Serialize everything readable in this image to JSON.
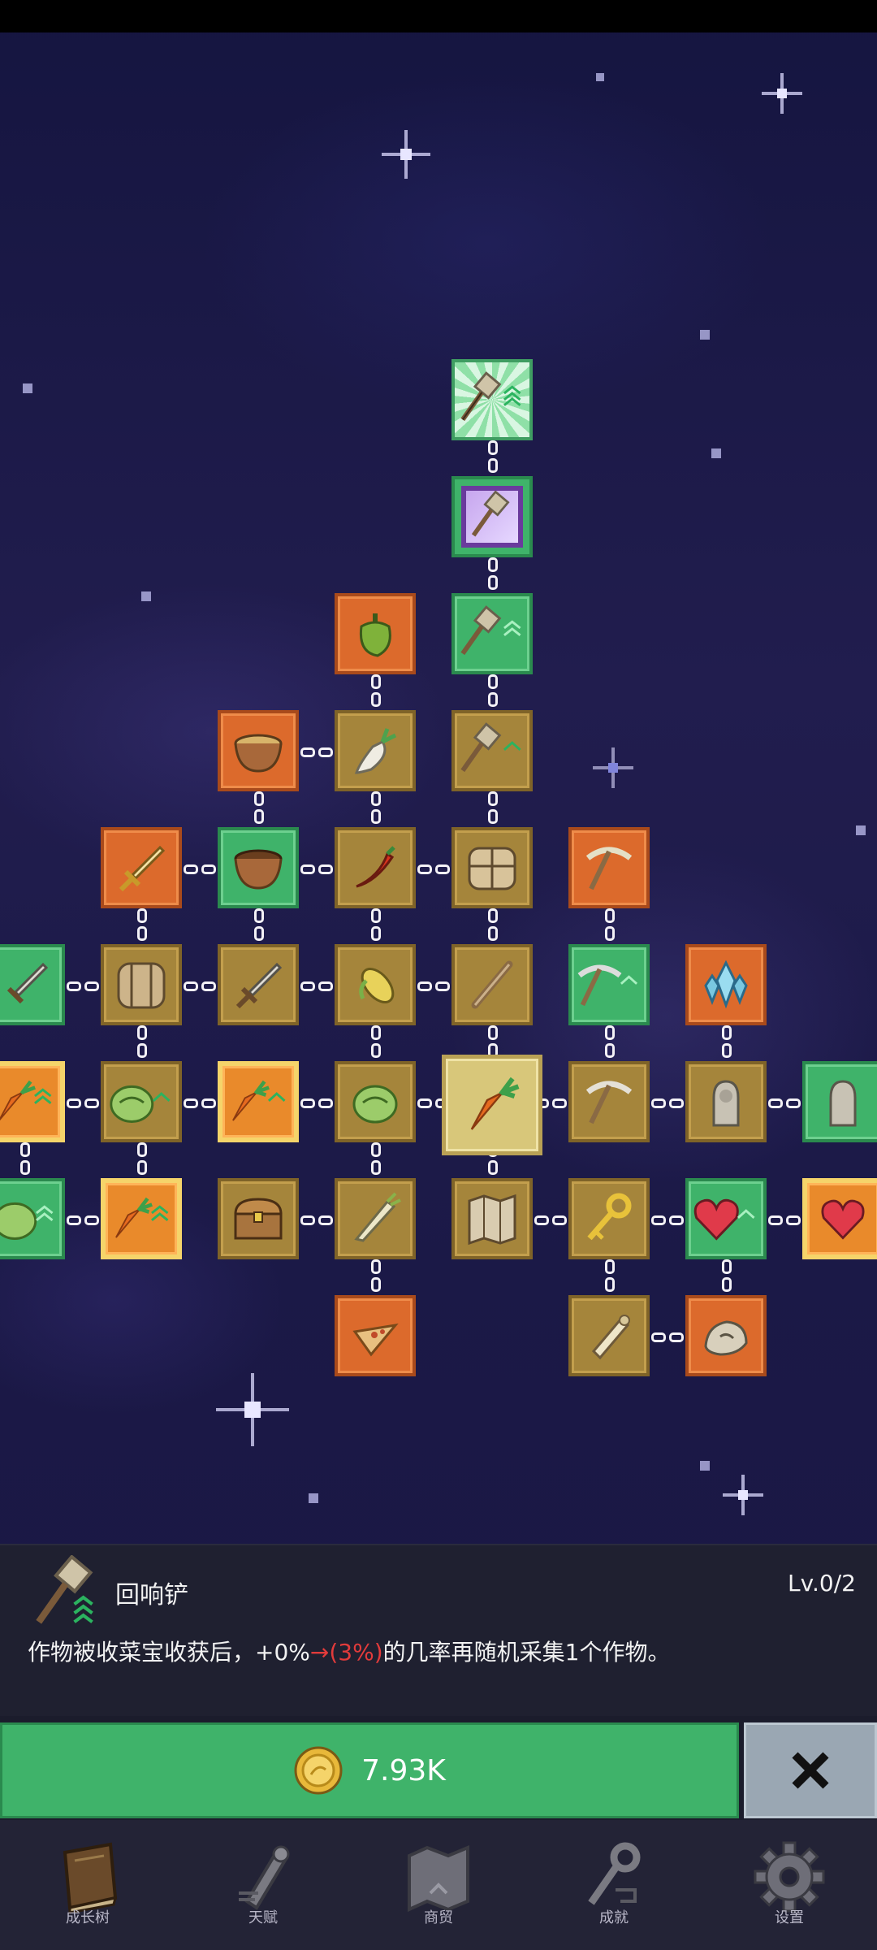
{
  "skill": {
    "name": "回响铲",
    "level": "Lv.0/2",
    "desc_prefix": "作物被收菜宝收获后，+0%",
    "desc_arrow": "→",
    "desc_highlight": "(3%)",
    "desc_suffix": "的几率再随机采集1个作物。"
  },
  "purchase": {
    "price": "7.93K",
    "coin_icon": "gold-coin-icon",
    "close_icon": "close-x-icon"
  },
  "nav": {
    "items": [
      {
        "label": "成长树",
        "icon": "book-icon"
      },
      {
        "label": "天赋",
        "icon": "scroll-icon"
      },
      {
        "label": "商贸",
        "icon": "map-icon"
      },
      {
        "label": "成就",
        "icon": "key-icon"
      },
      {
        "label": "设置",
        "icon": "gear-icon"
      }
    ]
  },
  "colors": {
    "node_tan": "#a5853b",
    "node_orange": "#dc6a2c",
    "node_green": "#3fb36a",
    "button_green": "#3fb36a",
    "close_gray": "#9aa7b3",
    "highlight_red": "#e23b3b"
  }
}
